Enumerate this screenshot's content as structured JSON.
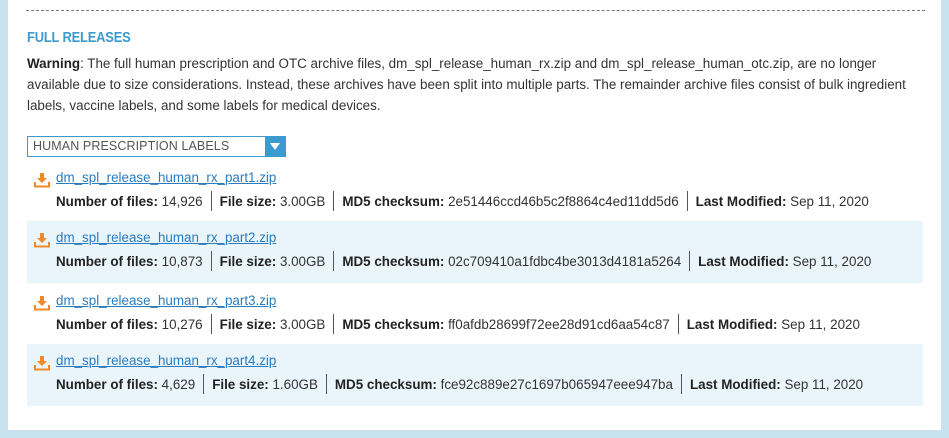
{
  "section": {
    "title": "FULL RELEASES",
    "warning_label": "Warning",
    "warning_text": ": The full human prescription and OTC archive files, dm_spl_release_human_rx.zip and dm_spl_release_human_otc.zip, are no longer available due to size considerations. Instead, these archives have been split into multiple parts. The remainder archive files consist of bulk ingredient labels, vaccine labels, and some labels for medical devices."
  },
  "dropdown": {
    "selected": "HUMAN PRESCRIPTION LABELS",
    "arrow_icon": "chevron-down-icon"
  },
  "labels": {
    "num_files": "Number of files:",
    "file_size": "File size:",
    "md5": "MD5 checksum:",
    "last_modified": "Last Modified:"
  },
  "colors": {
    "accent": "#3b9bcf",
    "download_icon": "#f0892a",
    "link": "#2a7bbf",
    "shaded_row": "#eaf5fb",
    "frame": "#c9e2ef"
  },
  "files": [
    {
      "name": "dm_spl_release_human_rx_part1.zip",
      "num_files": "14,926",
      "file_size": "3.00GB",
      "md5": "2e51446ccd46b5c2f8864c4ed11dd5d6",
      "last_modified": "Sep 11, 2020",
      "icon": "download-icon"
    },
    {
      "name": "dm_spl_release_human_rx_part2.zip",
      "num_files": "10,873",
      "file_size": "3.00GB",
      "md5": "02c709410a1fdbc4be3013d4181a5264",
      "last_modified": "Sep 11, 2020",
      "icon": "download-icon"
    },
    {
      "name": "dm_spl_release_human_rx_part3.zip",
      "num_files": "10,276",
      "file_size": "3.00GB",
      "md5": "ff0afdb28699f72ee28d91cd6aa54c87",
      "last_modified": "Sep 11, 2020",
      "icon": "download-icon"
    },
    {
      "name": "dm_spl_release_human_rx_part4.zip",
      "num_files": "4,629",
      "file_size": "1.60GB",
      "md5": "fce92c889e27c1697b065947eee947ba",
      "last_modified": "Sep 11, 2020",
      "icon": "download-icon"
    }
  ]
}
